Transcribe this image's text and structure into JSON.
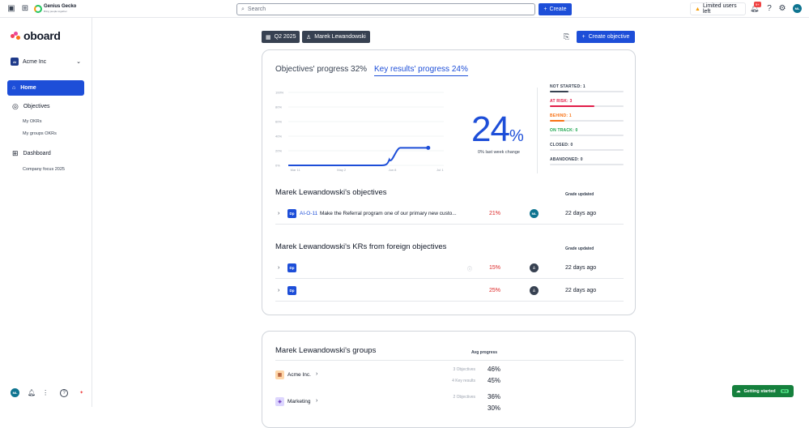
{
  "brand": {
    "name": "Genius Gecko",
    "sub": "Bring people together"
  },
  "search": {
    "placeholder": "Search"
  },
  "topbar": {
    "create_label": "Create",
    "limited_label": "Limited users left",
    "notif_badge": "9+",
    "avatar": "ML"
  },
  "sidebar": {
    "logo": "oboard",
    "org": {
      "badge": "AI",
      "name": "Acme Inc"
    },
    "home": "Home",
    "objectives": "Objectives",
    "my_okrs": "My OKRs",
    "my_groups_okrs": "My groups OKRs",
    "dashboard": "Dashboard",
    "company_focus": "Company focus 2025",
    "avatar": "ML"
  },
  "filters": {
    "period": "Q2 2025",
    "user": "Marek Lewandowski"
  },
  "header": {
    "create_objective": "Create objective"
  },
  "progress": {
    "tab_objectives": "Objectives' progress 32%",
    "tab_krs": "Key results' progress 24%",
    "big_value": "24",
    "big_unit": "%",
    "change": "0% last week change"
  },
  "chart_data": {
    "type": "line",
    "x": [
      "Mar 11",
      "May 2",
      "Jun 8",
      "Jul 1"
    ],
    "y_ticks": [
      "100%",
      "80%",
      "60%",
      "40%",
      "20%",
      "0%"
    ],
    "ylim": [
      0,
      100
    ],
    "series": [
      {
        "points": [
          [
            0,
            0
          ],
          [
            0.55,
            0
          ],
          [
            0.65,
            1
          ],
          [
            0.72,
            24
          ],
          [
            0.9,
            24
          ]
        ]
      }
    ],
    "color": "#1d4ed8"
  },
  "statuses": [
    {
      "label": "NOT STARTED: 1",
      "color": "#374151",
      "fraction": 0.25
    },
    {
      "label": "AT RISK: 3",
      "color": "#e11d48",
      "fraction": 0.6
    },
    {
      "label": "BEHIND: 1",
      "color": "#f97316",
      "fraction": 0.2
    },
    {
      "label": "ON TRACK: 0",
      "color": "#16a34a",
      "fraction": 0
    },
    {
      "label": "CLOSED: 0",
      "color": "#374151",
      "fraction": 0
    },
    {
      "label": "ABANDONED: 0",
      "color": "#374151",
      "fraction": 0
    }
  ],
  "objectives_section": {
    "title": "Marek Lewandowski's objectives",
    "grade_head": "Grade updated",
    "rows": [
      {
        "badge": "Dp",
        "id": "AI-O-11",
        "name": "Make the Referral program one of our primary new custo...",
        "pct": "21%",
        "avatar": "ML",
        "updated": "22 days ago"
      }
    ]
  },
  "foreign_section": {
    "title": "Marek Lewandowski's KRs from foreign objectives",
    "grade_head": "Grade updated",
    "rows": [
      {
        "badge": "Dp",
        "pct": "15%",
        "updated": "22 days ago"
      },
      {
        "badge": "Dp",
        "pct": "25%",
        "updated": "22 days ago"
      }
    ]
  },
  "groups_section": {
    "title": "Marek Lewandowski's groups",
    "avg_head": "Avg progress",
    "rows": [
      {
        "name": "Acme Inc.",
        "meta1": "3 Objectives",
        "val1": "46%",
        "meta2": "4 Key results",
        "val2": "45%"
      },
      {
        "name": "Marketing",
        "meta1": "2 Objectives",
        "val1": "36%",
        "meta2": "",
        "val2": "30%"
      }
    ]
  },
  "getting_started": {
    "label": "Getting started",
    "badge": "0/3"
  }
}
